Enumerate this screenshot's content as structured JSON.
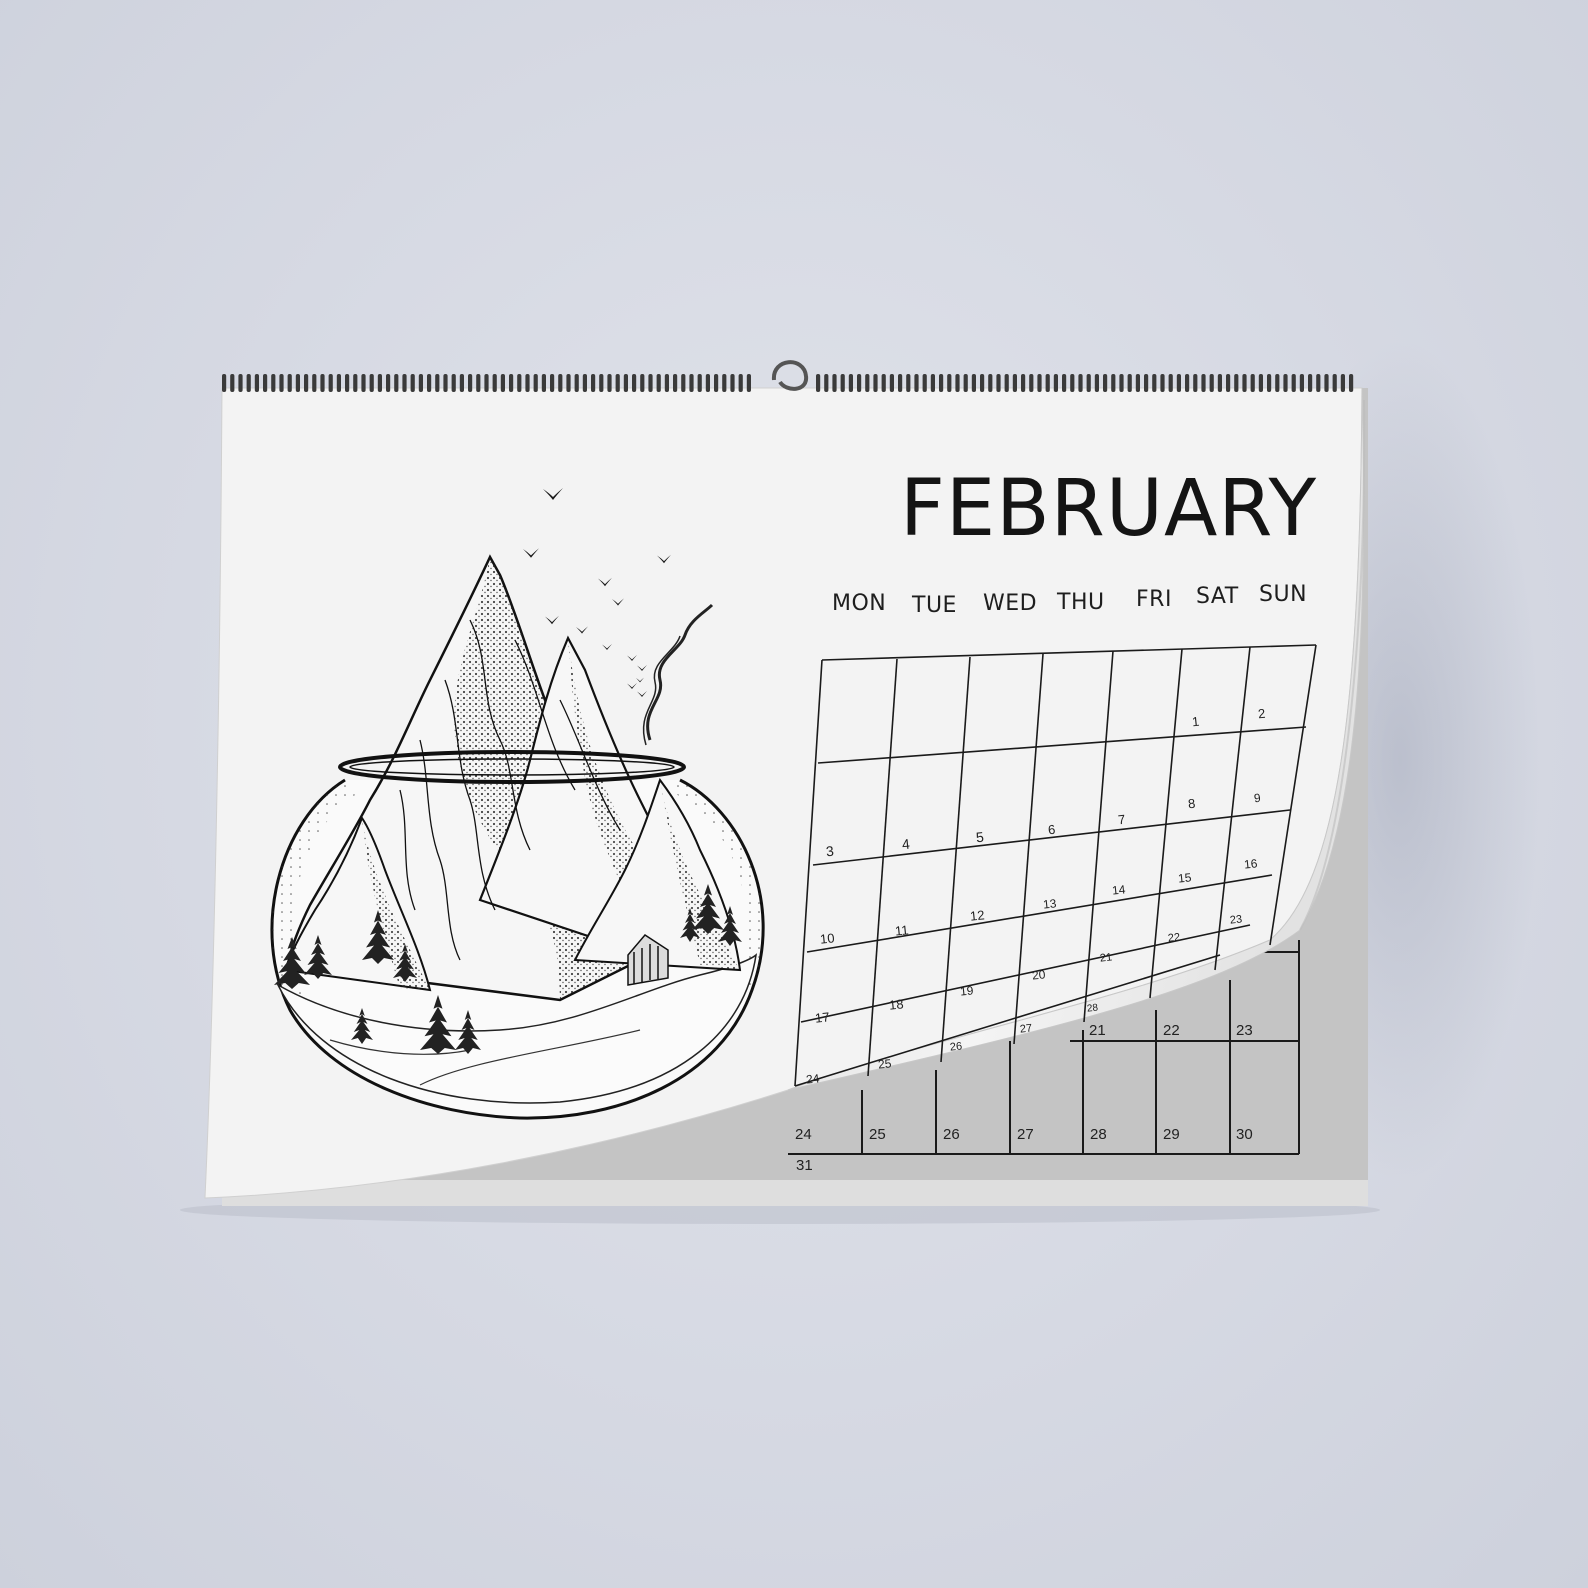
{
  "calendar": {
    "month": "FEBRUARY",
    "weekdays": [
      "MON",
      "TUE",
      "WED",
      "THU",
      "FRI",
      "SAT",
      "SUN"
    ],
    "front_page_dates": [
      "1",
      "2",
      "3",
      "4",
      "5",
      "6",
      "7",
      "8",
      "9",
      "10",
      "11",
      "12",
      "13",
      "14",
      "15",
      "16",
      "17",
      "18",
      "19",
      "20",
      "21",
      "22",
      "23",
      "24",
      "25",
      "26",
      "27",
      "28"
    ],
    "back_page_dates": [
      "21",
      "22",
      "23",
      "24",
      "25",
      "26",
      "27",
      "28",
      "29",
      "30",
      "31"
    ]
  },
  "colors": {
    "wall": "#d6d9e3",
    "paper": "#f1f1f1",
    "back_page": "#bdbdbd",
    "ink": "#141414"
  },
  "illustration": {
    "subject": "mountains inside glass fishbowl with pine trees, cabin, smoke and birds",
    "icons": [
      "bird-icon",
      "pine-tree-icon",
      "cabin-icon",
      "mountain-icon"
    ]
  }
}
